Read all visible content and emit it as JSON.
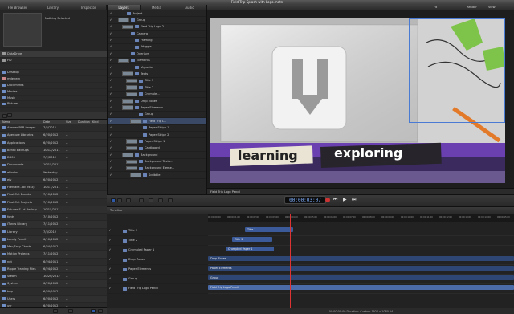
{
  "window": {
    "title": "Field Trip Splash with Logo.motn"
  },
  "left_tabs": [
    "File Browser",
    "Library",
    "Inspector"
  ],
  "inspector_preview": {
    "text": "Nothing Selected"
  },
  "sources": [
    {
      "label": "DataDrive",
      "selected": true
    },
    {
      "label": "HD",
      "selected": false
    },
    {
      "label": "",
      "selected": false
    },
    {
      "label": "Desktop",
      "selected": false
    },
    {
      "label": "mdehern",
      "selected": false
    },
    {
      "label": "Documents",
      "selected": false
    },
    {
      "label": "Movies",
      "selected": false
    },
    {
      "label": "Music",
      "selected": false
    },
    {
      "label": "Pictures",
      "selected": false
    }
  ],
  "file_table": {
    "columns": [
      "Name",
      "Date",
      "Size",
      "Duration",
      "Kind"
    ],
    "rows": [
      [
        "Aimees PSB images",
        "7/5/2011",
        "--"
      ],
      [
        "Aperture Libraries",
        "6/20/2012",
        "--"
      ],
      [
        "Applications",
        "6/20/2012",
        "--"
      ],
      [
        "Bento Backups",
        "10/12/2011",
        "--"
      ],
      [
        "DB03",
        "7/2/2012",
        "--"
      ],
      [
        "Documents",
        "10/15/2011",
        "--"
      ],
      [
        "eBooks",
        "Yesterday",
        "--"
      ],
      [
        "eiv",
        "6/20/2012",
        "--"
      ],
      [
        "FileMake...ac 9x 3)",
        "10/17/2011",
        "--"
      ],
      [
        "Final Cut Events",
        "7/10/2012",
        "--"
      ],
      [
        "Final Cut Projects",
        "7/10/2012",
        "--"
      ],
      [
        "Futures S...d Backup",
        "10/15/2011",
        "--"
      ],
      [
        "fonts",
        "7/10/2012",
        "--"
      ],
      [
        "iTunes Library",
        "7/11/2012",
        "--"
      ],
      [
        "Library",
        "7/3/2012",
        "--"
      ],
      [
        "Lonely Pencil",
        "6/10/2012",
        "--"
      ],
      [
        "Mac/Easy Charts",
        "6/24/2012",
        "--"
      ],
      [
        "Motion Projects",
        "7/11/2012",
        "--"
      ],
      [
        "not",
        "6/24/2011",
        "--"
      ],
      [
        "Ripple Training Files",
        "6/24/2012",
        "--"
      ],
      [
        "Steam",
        "10/20/2012",
        "--"
      ],
      [
        "System",
        "6/20/2012",
        "--"
      ],
      [
        "tmp",
        "6/20/2012",
        "--"
      ],
      [
        "Users",
        "6/20/2012",
        "--"
      ],
      [
        "usr",
        "6/20/2012",
        "--"
      ],
      [
        "var",
        "6/24/2011",
        "--"
      ],
      [
        "Video",
        "10/20/2012",
        "--"
      ]
    ]
  },
  "layer_tabs": [
    "Layers",
    "Media",
    "Audio"
  ],
  "layers": [
    {
      "name": "Project",
      "indent": 0,
      "thumb": false
    },
    {
      "name": "Group",
      "indent": 1,
      "thumb": true
    },
    {
      "name": "Field Trip Logo 2",
      "indent": 2,
      "thumb": true
    },
    {
      "name": "Camera",
      "indent": 1,
      "thumb": false
    },
    {
      "name": "Framing",
      "indent": 2,
      "thumb": false
    },
    {
      "name": "Wriggle",
      "indent": 2,
      "thumb": false
    },
    {
      "name": "Overlays",
      "indent": 1,
      "thumb": false
    },
    {
      "name": "Elements",
      "indent": 1,
      "thumb": true
    },
    {
      "name": "Vignette",
      "indent": 2,
      "thumb": false
    },
    {
      "name": "Texts",
      "indent": 2,
      "thumb": true
    },
    {
      "name": "Title 1",
      "indent": 3,
      "thumb": true
    },
    {
      "name": "Title 2",
      "indent": 3,
      "thumb": true
    },
    {
      "name": "Crumple...",
      "indent": 3,
      "thumb": true
    },
    {
      "name": "Drop Zones",
      "indent": 2,
      "thumb": true
    },
    {
      "name": "Paper Elements",
      "indent": 2,
      "thumb": true
    },
    {
      "name": "Group",
      "indent": 3,
      "thumb": false
    },
    {
      "name": "Field Trip L...",
      "indent": 4,
      "thumb": true,
      "selected": true
    },
    {
      "name": "Paper Stripe 1",
      "indent": 4,
      "thumb": false
    },
    {
      "name": "Paper Stripe 2",
      "indent": 4,
      "thumb": false
    },
    {
      "name": "Paper Stripe 1",
      "indent": 3,
      "thumb": true
    },
    {
      "name": "Cardboard",
      "indent": 3,
      "thumb": true
    },
    {
      "name": "Background",
      "indent": 2,
      "thumb": true
    },
    {
      "name": "Background Textu...",
      "indent": 3,
      "thumb": true
    },
    {
      "name": "Background Eleme...",
      "indent": 3,
      "thumb": true
    },
    {
      "name": "Scribble",
      "indent": 4,
      "thumb": true
    }
  ],
  "canvas": {
    "topbar_left": "Fit",
    "topbar_items": [
      "Render",
      "View"
    ],
    "camera_label": "Active Camera",
    "selected_label": "Field Trip Logo Pencil",
    "words": [
      "learning",
      "exploring"
    ]
  },
  "transport": {
    "timecode": "00:00:03:07"
  },
  "timeline": {
    "label": "Timeline",
    "ruler": [
      "00:00:00:00",
      "00:00:01:00",
      "00:00:02:00",
      "00:00:03:00",
      "00:00:04:00",
      "00:00:05:00",
      "00:00:06:00",
      "00:00:07:00",
      "00:00:08:00",
      "00:00:09:00",
      "00:00:10:00",
      "00:00:11:00",
      "00:00:12:00",
      "00:00:13:00",
      "00:00:14:00",
      "00:00:15:00"
    ],
    "tracks": [
      {
        "name": "Title 1",
        "bar": "Title 1"
      },
      {
        "name": "Title 2",
        "bar": "Title 2"
      },
      {
        "name": "Crumpled Paper 1",
        "bar": "Crumpled Paper 1"
      },
      {
        "name": "Drop Zones",
        "bar": "Drop Zones"
      },
      {
        "name": "Paper Elements",
        "bar": "Paper Elements"
      },
      {
        "name": "Group",
        "bar": "Group"
      },
      {
        "name": "Field Trip Logo Pencil",
        "bar": "Field Trip Logo Pencil"
      }
    ],
    "status": "00:00:00:00 Duration: Custom 1920 x 1080 24"
  }
}
